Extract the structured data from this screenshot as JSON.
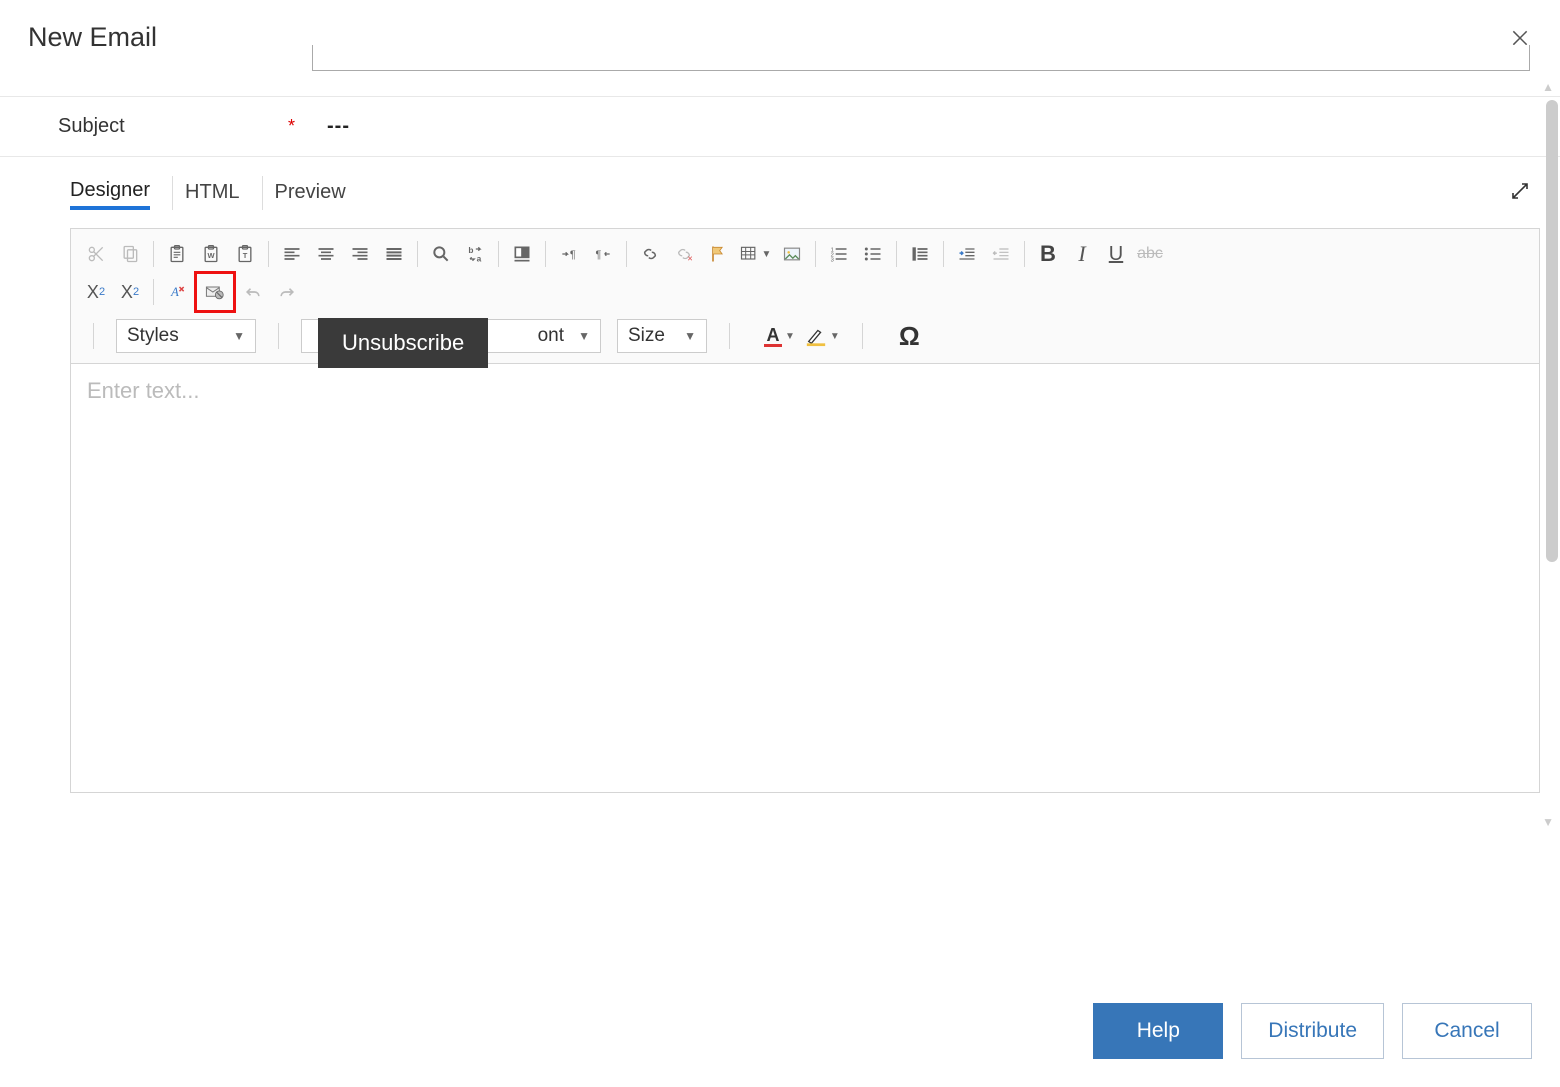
{
  "dialog": {
    "title": "New Email"
  },
  "subject": {
    "label": "Subject",
    "required": "*",
    "value": "---"
  },
  "tabs": {
    "designer": "Designer",
    "html": "HTML",
    "preview": "Preview"
  },
  "tooltip": {
    "text": "Unsubscribe"
  },
  "selects": {
    "styles_label": "Styles",
    "font_partial": "ont",
    "size_label": "Size"
  },
  "editor": {
    "placeholder": "Enter text..."
  },
  "footer": {
    "help": "Help",
    "distribute": "Distribute",
    "cancel": "Cancel"
  }
}
